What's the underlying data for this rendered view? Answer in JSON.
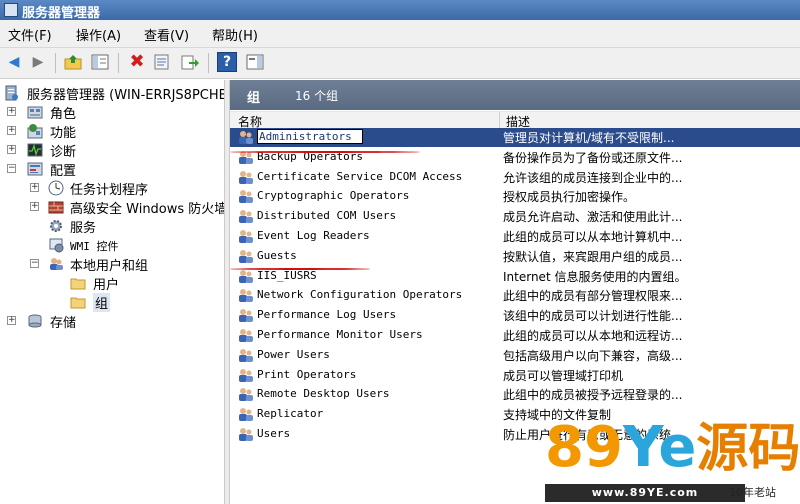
{
  "window": {
    "title": "服务器管理器"
  },
  "menu": [
    "文件(F)",
    "操作(A)",
    "查看(V)",
    "帮助(H)"
  ],
  "toolbar": [
    "back-icon",
    "forward-icon",
    "up-folder-icon",
    "show-hide-tree-icon",
    "delete-icon",
    "properties-icon",
    "export-list-icon",
    "help-icon",
    "action-pane-icon"
  ],
  "tree": {
    "root": "服务器管理器  (WIN-ERRJS8PCHB",
    "roles": "角色",
    "features": "功能",
    "diagnostics": "诊断",
    "config": "配置",
    "task_scheduler": "任务计划程序",
    "firewall": "高级安全 Windows 防火墙",
    "services": "服务",
    "wmi": "WMI 控件",
    "local_users": "本地用户和组",
    "users": "用户",
    "groups": "组",
    "storage": "存储"
  },
  "panel": {
    "title": "组",
    "count": "16 个组"
  },
  "columns": {
    "name": "名称",
    "desc": "描述"
  },
  "groups": [
    {
      "name": "Administrators",
      "desc": "管理员对计算机/域有不受限制..."
    },
    {
      "name": "Backup Operators",
      "desc": "备份操作员为了备份或还原文件..."
    },
    {
      "name": "Certificate Service DCOM Access",
      "desc": "允许该组的成员连接到企业中的..."
    },
    {
      "name": "Cryptographic Operators",
      "desc": "授权成员执行加密操作。"
    },
    {
      "name": "Distributed COM Users",
      "desc": "成员允许启动、激活和使用此计..."
    },
    {
      "name": "Event Log Readers",
      "desc": "此组的成员可以从本地计算机中..."
    },
    {
      "name": "Guests",
      "desc": "按默认值，来宾跟用户组的成员..."
    },
    {
      "name": "IIS_IUSRS",
      "desc": "Internet 信息服务使用的内置组。"
    },
    {
      "name": "Network Configuration Operators",
      "desc": "此组中的成员有部分管理权限来..."
    },
    {
      "name": "Performance Log Users",
      "desc": "该组中的成员可以计划进行性能..."
    },
    {
      "name": "Performance Monitor Users",
      "desc": "此组的成员可以从本地和远程访..."
    },
    {
      "name": "Power Users",
      "desc": "包括高级用户以向下兼容，高级..."
    },
    {
      "name": "Print Operators",
      "desc": "成员可以管理域打印机"
    },
    {
      "name": "Remote Desktop Users",
      "desc": "此组中的成员被授予远程登录的..."
    },
    {
      "name": "Replicator",
      "desc": "支持域中的文件复制"
    },
    {
      "name": "Users",
      "desc": "防止用户进行有意或无意的系统..."
    }
  ],
  "watermark": {
    "logo_text": "89Ye源码",
    "url": "www.89YE.com",
    "tag": "10年老站"
  },
  "colors": {
    "selection": "#2a4c8c",
    "header_band": "#5f6f86",
    "annotation_red": "#d01010"
  }
}
